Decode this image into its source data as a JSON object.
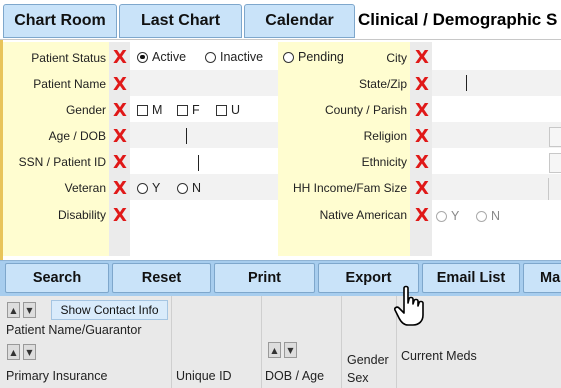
{
  "tabs": [
    "Chart Room",
    "Last Chart",
    "Calendar"
  ],
  "page_title": "Clinical / Demographic S",
  "left_fields": {
    "patient_status": {
      "label": "Patient Status",
      "options": [
        "Active",
        "Inactive",
        "Pending"
      ],
      "selected": "Active"
    },
    "patient_name": {
      "label": "Patient Name"
    },
    "gender": {
      "label": "Gender",
      "options": [
        "M",
        "F",
        "U"
      ]
    },
    "age_dob": {
      "label": "Age / DOB"
    },
    "ssn": {
      "label": "SSN / Patient ID"
    },
    "veteran": {
      "label": "Veteran",
      "options": [
        "Y",
        "N"
      ]
    },
    "disability": {
      "label": "Disability"
    }
  },
  "right_fields": {
    "city": {
      "label": "City"
    },
    "state_zip": {
      "label": "State/Zip"
    },
    "county": {
      "label": "County / Parish"
    },
    "religion": {
      "label": "Religion"
    },
    "ethnicity": {
      "label": "Ethnicity"
    },
    "hh_income": {
      "label": "HH Income/Fam Size"
    },
    "native_american": {
      "label": "Native American",
      "options": [
        "Y",
        "N"
      ]
    }
  },
  "clear_glyph": "X",
  "actions": [
    "Search",
    "Reset",
    "Print",
    "Export",
    "Email List",
    "Ma"
  ],
  "grid": {
    "show_contact": "Show Contact Info",
    "col_patient_name": "Patient Name/Guarantor",
    "col_primary_ins": "Primary Insurance",
    "col_unique_id": "Unique ID",
    "col_dob_age": "DOB / Age",
    "col_gender": "Gender",
    "col_sex": "Sex",
    "col_meds": "Current Meds"
  },
  "icons": {
    "clear": "clear-x-icon",
    "sort_up": "sort-up-icon",
    "sort_down": "sort-down-icon",
    "cursor": "hand-cursor-icon"
  },
  "colors": {
    "tab_bg": "#c9e3f9",
    "label_bg": "#fffdd0",
    "clear_x": "#e01818",
    "action_bar": "#a7cdee"
  }
}
